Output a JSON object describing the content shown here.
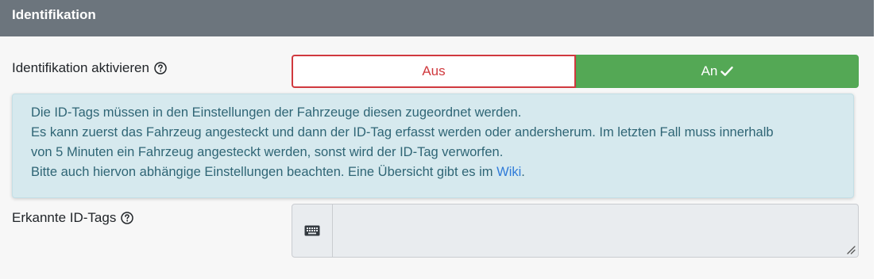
{
  "header": {
    "title": "Identifikation"
  },
  "activate": {
    "label": "Identifikation aktivieren",
    "off_label": "Aus",
    "on_label": "An",
    "selected": "An"
  },
  "info": {
    "line1": "Die ID-Tags müssen in den Einstellungen der Fahrzeuge diesen zugeordnet werden.",
    "line2a": "Es kann zuerst das Fahrzeug angesteckt und dann der ID-Tag erfasst werden oder andersherum. Im letzten Fall muss innerhalb",
    "line2b": "von 5 Minuten ein Fahrzeug angesteckt werden, sonst wird der ID-Tag verworfen.",
    "line3_prefix": "Bitte auch hiervon abhängige Einstellungen beachten. Eine Übersicht gibt es im ",
    "line3_link": "Wiki",
    "line3_suffix": "."
  },
  "tags": {
    "label": "Erkannte ID-Tags",
    "value": ""
  },
  "icons": {
    "help": "question-circle-icon",
    "check": "check-icon",
    "keyboard": "keyboard-icon"
  },
  "colors": {
    "header_bg": "#6c757d",
    "off_red": "#d0393e",
    "on_green": "#54a855",
    "info_bg": "#d6e9ee",
    "info_text": "#2f6575",
    "link": "#2f7bd9"
  }
}
